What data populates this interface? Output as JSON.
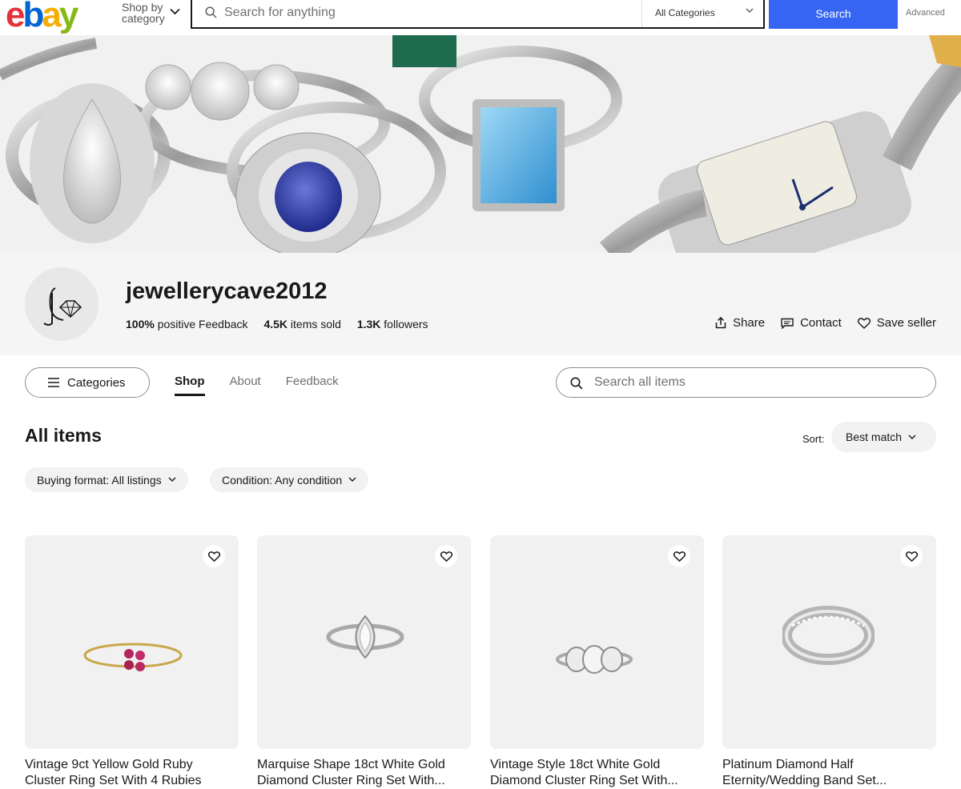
{
  "header": {
    "logo_letters": [
      "e",
      "b",
      "a",
      "y"
    ],
    "shop_by_line1": "Shop by",
    "shop_by_line2": "category",
    "search_placeholder": "Search for anything",
    "category_select": "All Categories",
    "search_button": "Search",
    "advanced_link": "Advanced"
  },
  "seller": {
    "name": "jewellerycave2012",
    "feedback_value": "100%",
    "feedback_label": "positive Feedback",
    "items_sold_value": "4.5K",
    "items_sold_label": "items sold",
    "followers_value": "1.3K",
    "followers_label": "followers",
    "actions": {
      "share": "Share",
      "contact": "Contact",
      "save": "Save seller"
    }
  },
  "nav": {
    "categories_button": "Categories",
    "tabs": [
      "Shop",
      "About",
      "Feedback"
    ],
    "active_tab": "Shop",
    "store_search_placeholder": "Search all items"
  },
  "listing": {
    "heading": "All items",
    "sort_label": "Sort:",
    "sort_value": "Best match",
    "filters": [
      "Buying format: All listings",
      "Condition: Any condition"
    ],
    "items": [
      {
        "title_line1": "Vintage 9ct Yellow Gold Ruby",
        "title_line2": "Cluster Ring Set With 4 Rubies"
      },
      {
        "title_line1": "Marquise Shape 18ct White Gold",
        "title_line2": "Diamond Cluster Ring Set With..."
      },
      {
        "title_line1": "Vintage Style 18ct White Gold",
        "title_line2": "Diamond Cluster Ring Set With..."
      },
      {
        "title_line1": "Platinum Diamond Half",
        "title_line2": "Eternity/Wedding Band Set..."
      }
    ]
  },
  "colors": {
    "accent": "#3665f3",
    "ebay_red": "#e53238",
    "ebay_blue": "#0064d2",
    "ebay_yellow": "#f5af02",
    "ebay_green": "#86b817"
  }
}
